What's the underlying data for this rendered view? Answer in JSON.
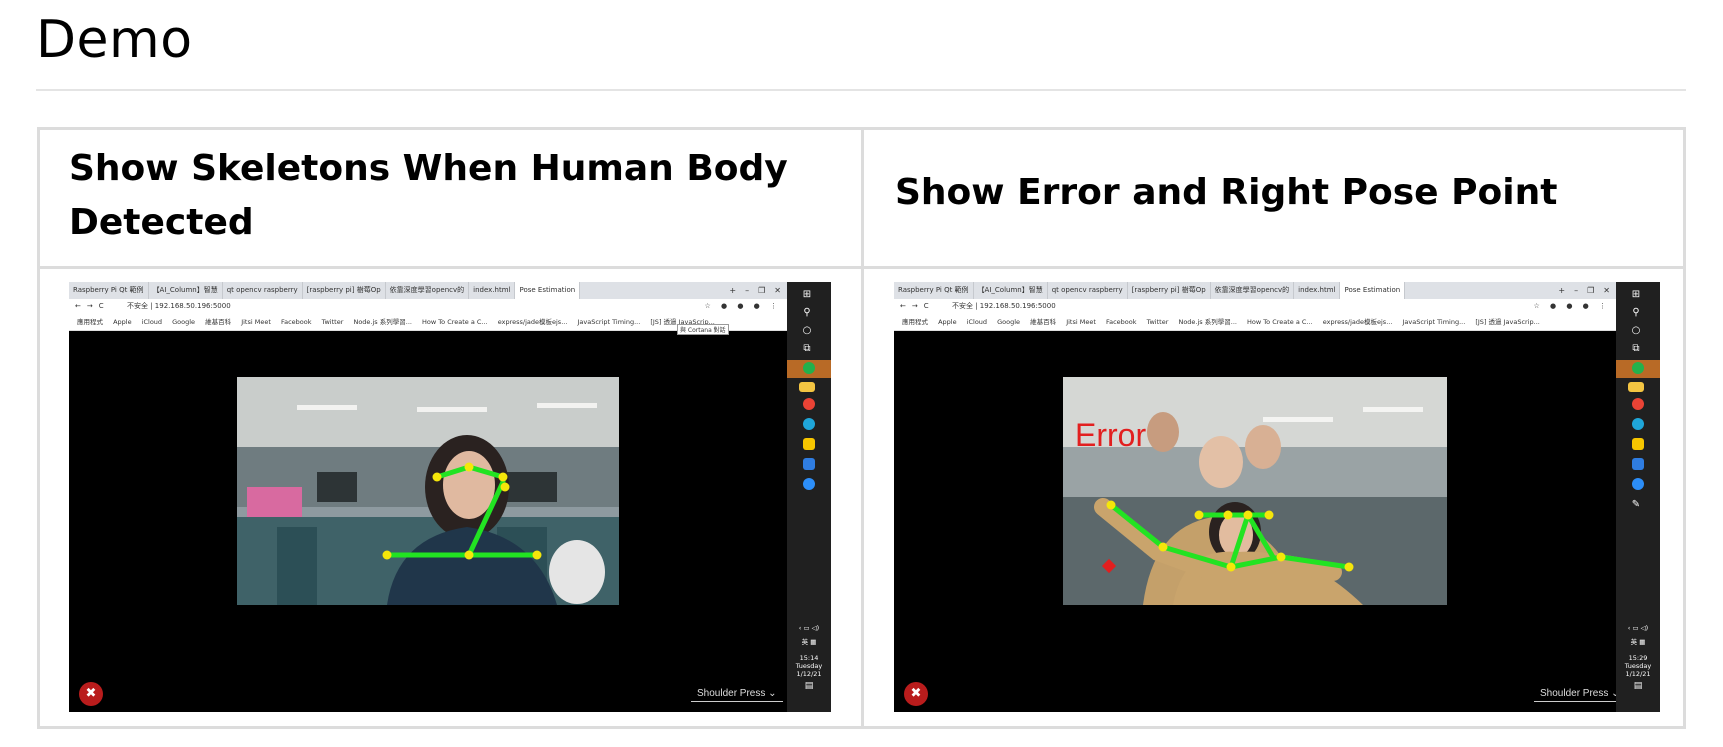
{
  "heading": "Demo",
  "table": {
    "col1_header": "Show Skeletons When Human Body Detected",
    "col2_header": "Show Error and Right Pose Point"
  },
  "screenshot_left": {
    "tabs": [
      "Raspberry Pi Qt 範例",
      "【AI_Column】智慧",
      "qt opencv raspberry",
      "[raspberry pi] 樹莓Op",
      "依靠深度學習opencv的",
      "index.html",
      "",
      "Pose Estimation"
    ],
    "url": "不安全 | 192.168.50.196:5000",
    "bookmarks": [
      "應用程式",
      "Apple",
      "iCloud",
      "Google",
      "維基百科",
      "Jitsi Meet",
      "Facebook",
      "Twitter",
      "Node.js 系列學習...",
      "How To Create a C...",
      "express/jade模板ejs...",
      "JavaScript Timing...",
      "[JS] 透過 JavaScrip..."
    ],
    "tooltip": "與 Cortana 對話",
    "select_value": "Shoulder Press",
    "clock_time": "15:14",
    "clock_day": "Tuesday",
    "clock_date": "1/12/21"
  },
  "screenshot_right": {
    "tabs": [
      "Raspberry Pi Qt 範例",
      "【AI_Column】智慧",
      "qt opencv raspberry",
      "[raspberry pi] 樹莓Op",
      "依靠深度學習opencv的",
      "index.html",
      "",
      "Pose Estimation"
    ],
    "url": "不安全 | 192.168.50.196:5000",
    "bookmarks": [
      "應用程式",
      "Apple",
      "iCloud",
      "Google",
      "維基百科",
      "Jitsi Meet",
      "Facebook",
      "Twitter",
      "Node.js 系列學習...",
      "How To Create a C...",
      "express/jade模板ejs...",
      "JavaScript Timing...",
      "[JS] 透過 JavaScrip..."
    ],
    "overlay_label": "Error",
    "select_value": "Shoulder Press",
    "clock_time": "15:29",
    "clock_day": "Tuesday",
    "clock_date": "1/12/21"
  },
  "colors": {
    "skeleton_line": "#22e322",
    "joint_point": "#f5e60a",
    "error_point": "#e21f1f"
  }
}
